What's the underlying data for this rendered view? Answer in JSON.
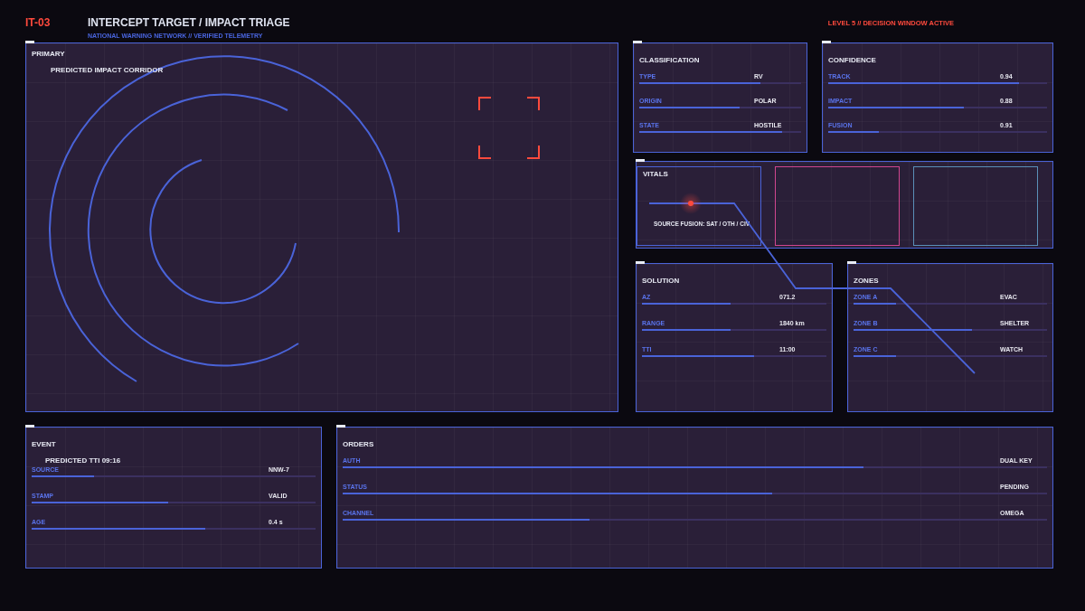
{
  "header": {
    "code": "IT-03",
    "title": "INTERCEPT TARGET / IMPACT TRIAGE",
    "subtitle": "NATIONAL WARNING NETWORK // VERIFIED TELEMETRY",
    "alert": "LEVEL 5 // DECISION WINDOW ACTIVE"
  },
  "primary": {
    "title": "PRIMARY",
    "caption": "PREDICTED IMPACT CORRIDOR"
  },
  "classification": {
    "title": "CLASSIFICATION",
    "rows": [
      {
        "label": "TYPE",
        "value": "RV",
        "level": 0.75
      },
      {
        "label": "ORIGIN",
        "value": "POLAR",
        "level": 0.62
      },
      {
        "label": "STATE",
        "value": "HOSTILE",
        "level": 0.88
      }
    ]
  },
  "confidence": {
    "title": "CONFIDENCE",
    "rows": [
      {
        "label": "TRACK",
        "value": "0.94",
        "level": 0.87
      },
      {
        "label": "IMPACT",
        "value": "0.88",
        "level": 0.62
      },
      {
        "label": "FUSION",
        "value": "0.91",
        "level": 0.23
      }
    ]
  },
  "vitals": {
    "monitors": [
      {
        "color": "#4a63d8",
        "title": "VITALS",
        "caption": "SOURCE FUSION: SAT / OTH / CIV"
      },
      {
        "color": "#d0468f"
      },
      {
        "color": "#5a8fb8"
      }
    ]
  },
  "solution": {
    "title": "SOLUTION",
    "rows": [
      {
        "label": "AZ",
        "value": "071.2",
        "level": 0.48
      },
      {
        "label": "RANGE",
        "value": "1840 km",
        "level": 0.48
      },
      {
        "label": "TTI",
        "value": "11:00",
        "level": 0.61
      }
    ]
  },
  "zones": {
    "title": "ZONES",
    "rows": [
      {
        "label": "ZONE A",
        "value": "EVAC",
        "level": 0.22
      },
      {
        "label": "ZONE B",
        "value": "SHELTER",
        "level": 0.61
      },
      {
        "label": "ZONE C",
        "value": "WATCH",
        "level": 0.22
      }
    ]
  },
  "event": {
    "title": "EVENT",
    "headline": "PREDICTED TTI 09:16",
    "rows": [
      {
        "label": "SOURCE",
        "value": "NNW-7",
        "level": 0.22
      },
      {
        "label": "STAMP",
        "value": "VALID",
        "level": 0.48
      },
      {
        "label": "AGE",
        "value": "0.4 s",
        "level": 0.61
      }
    ]
  },
  "orders": {
    "title": "ORDERS",
    "rows": [
      {
        "label": "AUTH",
        "value": "DUAL KEY",
        "level": 0.74
      },
      {
        "label": "STATUS",
        "value": "PENDING",
        "level": 0.61
      },
      {
        "label": "CHANNEL",
        "value": "OMEGA",
        "level": 0.35
      }
    ]
  }
}
